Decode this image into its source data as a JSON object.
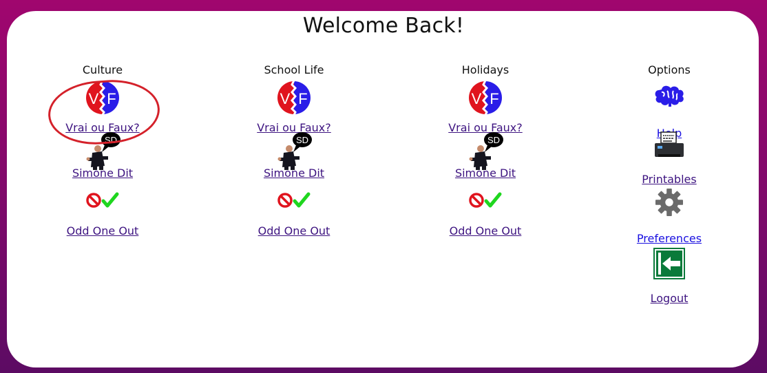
{
  "page": {
    "title": "Welcome Back!"
  },
  "columns": [
    {
      "heading": "Culture",
      "items": [
        {
          "icon": "vrai-ou-faux-icon",
          "label": "Vrai ou Faux?"
        },
        {
          "icon": "simone-dit-icon",
          "label": "Simone Dit"
        },
        {
          "icon": "odd-one-out-icon",
          "label": "Odd One Out"
        }
      ]
    },
    {
      "heading": "School Life",
      "items": [
        {
          "icon": "vrai-ou-faux-icon",
          "label": "Vrai ou Faux?"
        },
        {
          "icon": "simone-dit-icon",
          "label": "Simone Dit"
        },
        {
          "icon": "odd-one-out-icon",
          "label": "Odd One Out"
        }
      ]
    },
    {
      "heading": "Holidays",
      "items": [
        {
          "icon": "vrai-ou-faux-icon",
          "label": "Vrai ou Faux?"
        },
        {
          "icon": "simone-dit-icon",
          "label": "Simone Dit"
        },
        {
          "icon": "odd-one-out-icon",
          "label": "Odd One Out"
        }
      ]
    }
  ],
  "options": {
    "heading": "Options",
    "items": [
      {
        "icon": "brain-help-icon",
        "label": "Help"
      },
      {
        "icon": "printer-icon",
        "label": "Printables"
      },
      {
        "icon": "gear-icon",
        "label": "Preferences"
      },
      {
        "icon": "exit-door-icon",
        "label": "Logout"
      }
    ]
  },
  "icon_text": {
    "vf_v": "V",
    "vf_f": "F",
    "sd": "SD"
  },
  "colors": {
    "background": "#a0066e",
    "link": "#3d1380",
    "options_link": "#1a10e0",
    "annotation": "#d4212a",
    "vf_red": "#e0141e",
    "vf_blue": "#2a1de8",
    "check_green": "#1fd61f",
    "no_red": "#e0141e",
    "logout_green": "#0a7a3a"
  }
}
